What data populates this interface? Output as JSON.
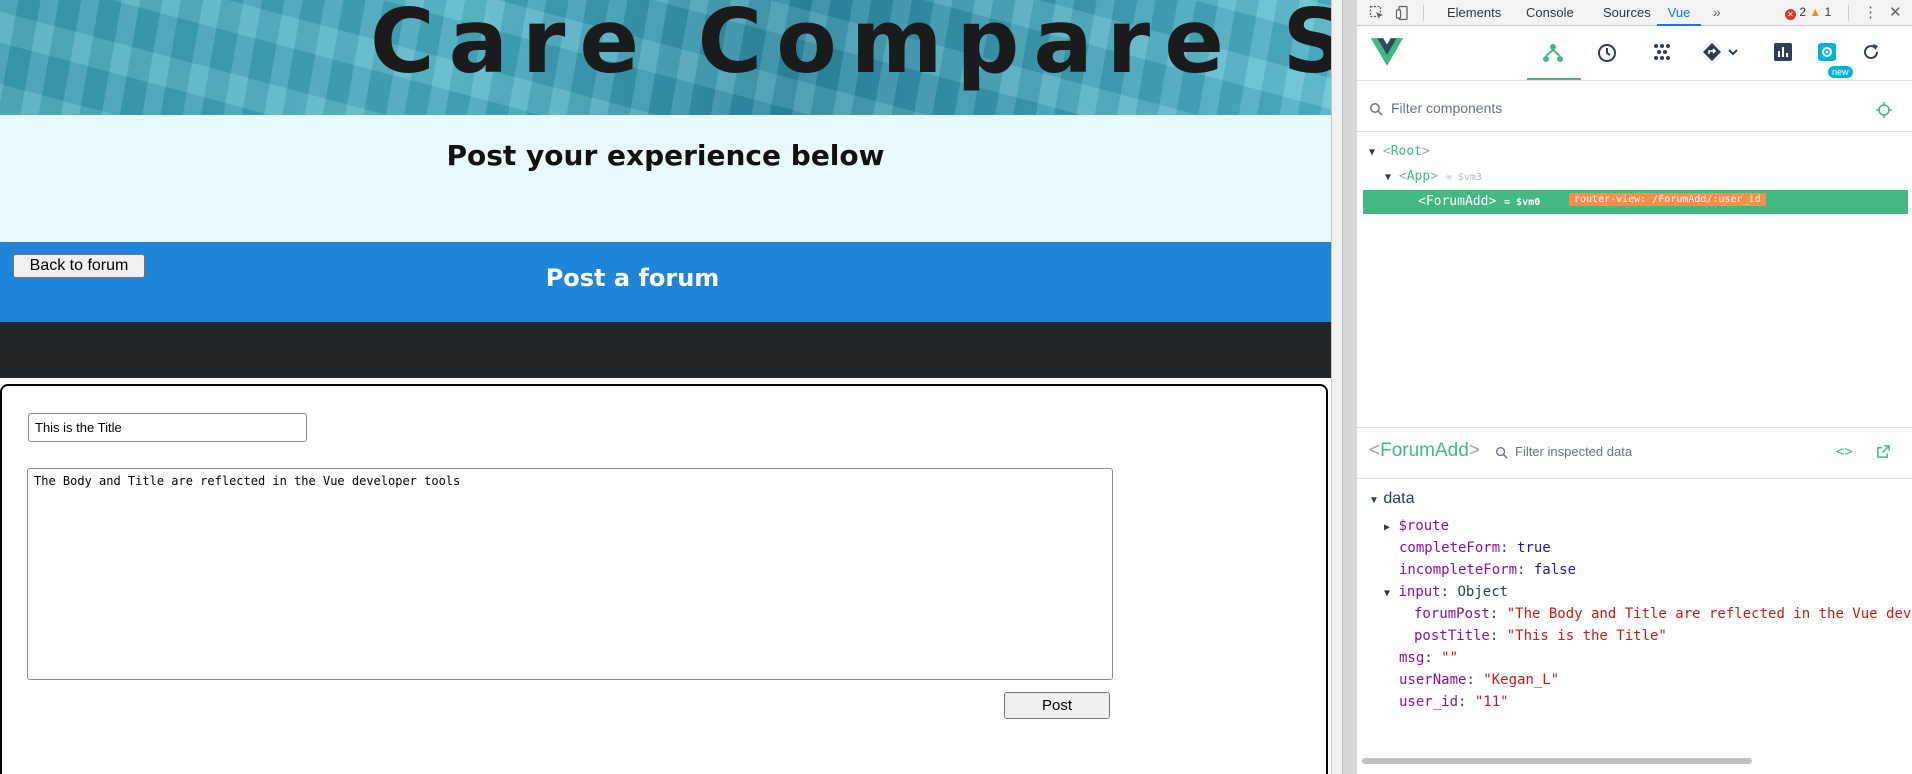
{
  "app": {
    "banner_title": "Care Compare SK",
    "page_heading": "Post your experience below",
    "back_button": "Back to forum",
    "form_heading": "Post a forum",
    "title_value": "This is the Title",
    "body_value": "The Body and Title are reflected in the Vue developer tools",
    "post_button": "Post"
  },
  "devtools": {
    "tabs": [
      "Elements",
      "Console",
      "Sources",
      "Vue"
    ],
    "active_tab": "Vue",
    "more_tabs_icon": "double-chevron-icon",
    "error_count": "2",
    "warning_count": "1",
    "new_badge": "new",
    "filter_placeholder": "Filter components",
    "tree": {
      "root": "Root",
      "app": "App",
      "app_ref": "= $vm3",
      "selected": "ForumAdd",
      "selected_ref": "= $vm0",
      "router_badge": "router-view: /ForumAdd/:user_id"
    },
    "inspector": {
      "component_name": "ForumAdd",
      "filter_placeholder": "Filter inspected data",
      "section": "data",
      "route_key": "$route",
      "complete_form_key": "completeForm",
      "complete_form_value": "true",
      "incomplete_form_key": "incompleteForm",
      "incomplete_form_value": "false",
      "input_key": "input",
      "input_value": "Object",
      "forum_post_key": "forumPost",
      "forum_post_value": "\"The Body and Title are reflected in the Vue dev",
      "post_title_key": "postTitle",
      "post_title_value": "\"This is the Title\"",
      "msg_key": "msg",
      "msg_value": "\"\"",
      "user_name_key": "userName",
      "user_name_value": "\"Kegan_L\"",
      "user_id_key": "user_id",
      "user_id_value": "\"11\""
    },
    "colors": {
      "vue_green": "#42b883",
      "active_blue": "#1a73e8",
      "router_orange": "#ff8c4b"
    }
  }
}
